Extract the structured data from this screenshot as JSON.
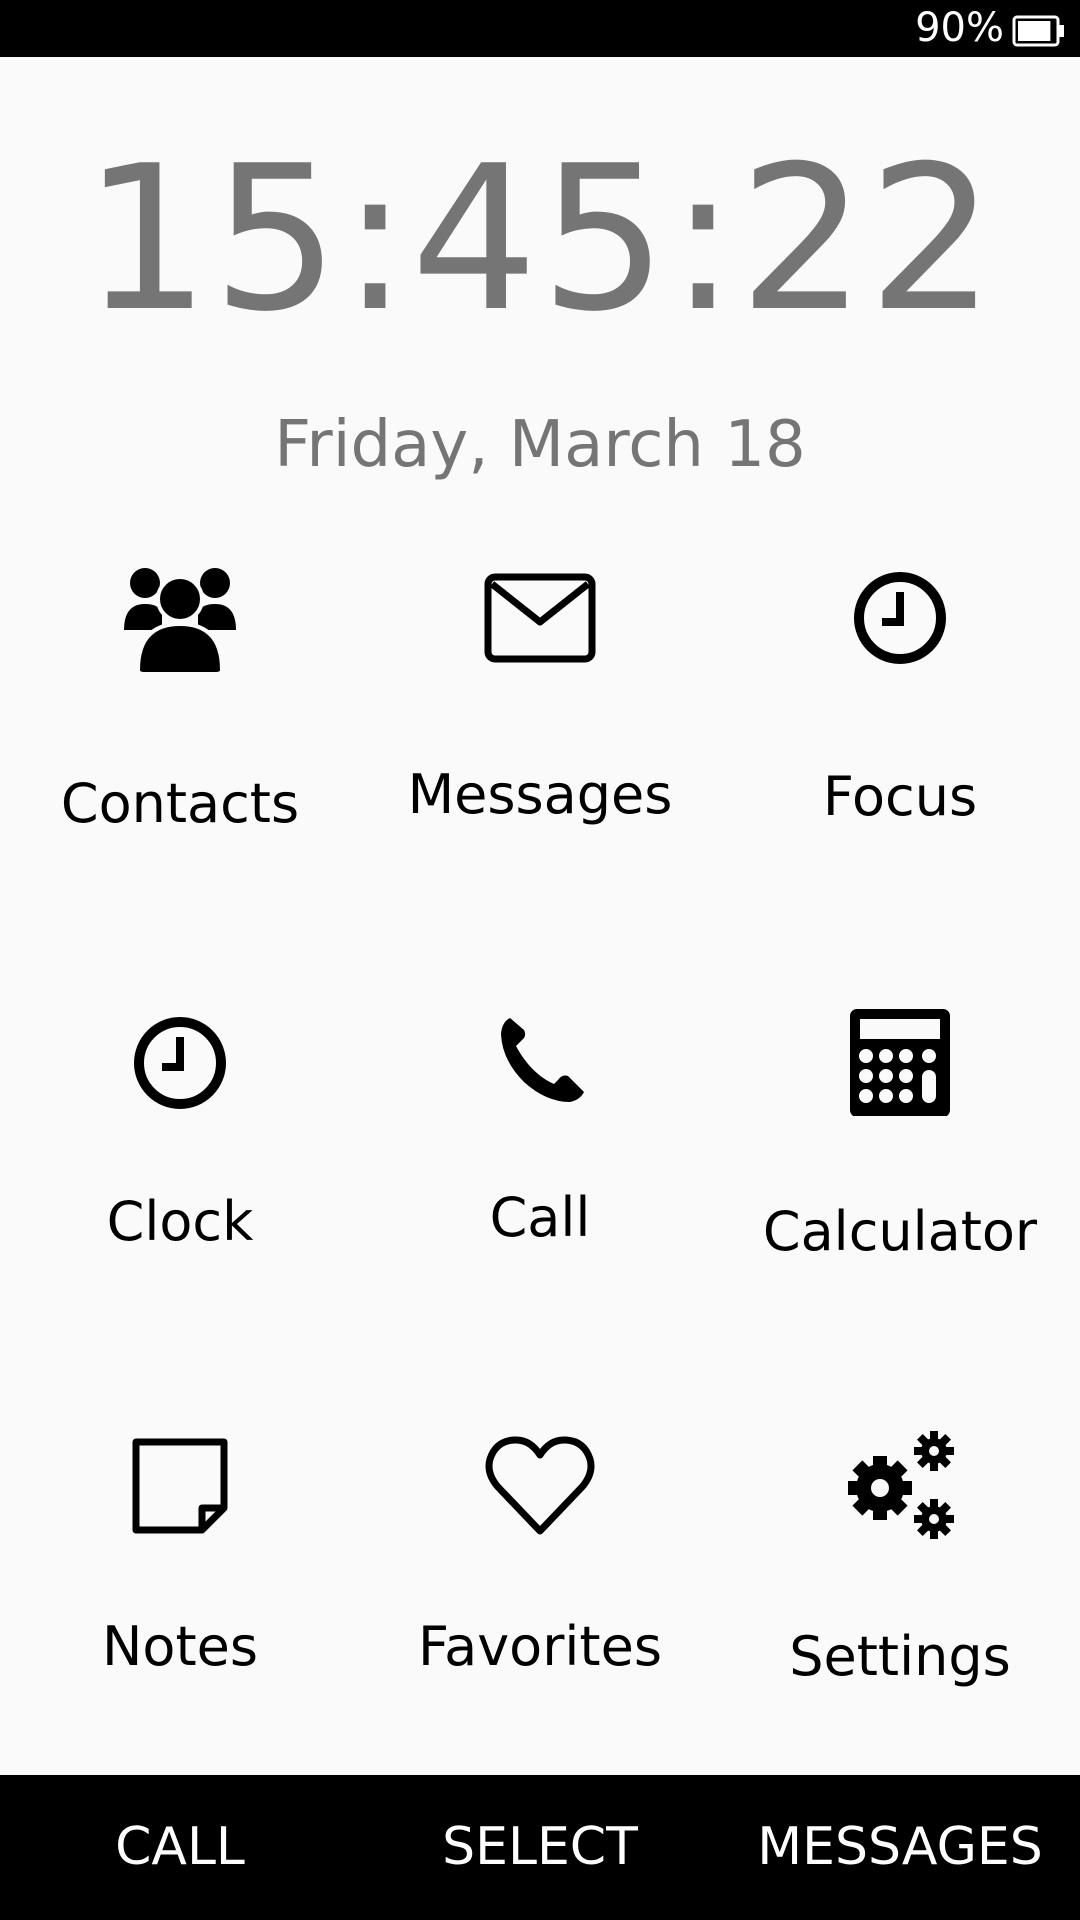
{
  "status_bar": {
    "battery_percent_text": "90%",
    "battery_level": 0.9
  },
  "clock": {
    "time": "15:45:22",
    "date": "Friday, March 18"
  },
  "apps": [
    {
      "label": "Contacts",
      "icon": "contacts-icon"
    },
    {
      "label": "Messages",
      "icon": "envelope-icon"
    },
    {
      "label": "Focus",
      "icon": "clock-icon"
    },
    {
      "label": "Clock",
      "icon": "clock-icon"
    },
    {
      "label": "Call",
      "icon": "phone-icon"
    },
    {
      "label": "Calculator",
      "icon": "calculator-icon"
    },
    {
      "label": "Notes",
      "icon": "note-icon"
    },
    {
      "label": "Favorites",
      "icon": "heart-icon"
    },
    {
      "label": "Settings",
      "icon": "gears-icon"
    }
  ],
  "softkeys": {
    "left": "CALL",
    "center": "SELECT",
    "right": "MESSAGES"
  },
  "colors": {
    "background": "#fafafa",
    "bars": "#000000",
    "clock_text": "#757575",
    "label_text": "#000000"
  }
}
